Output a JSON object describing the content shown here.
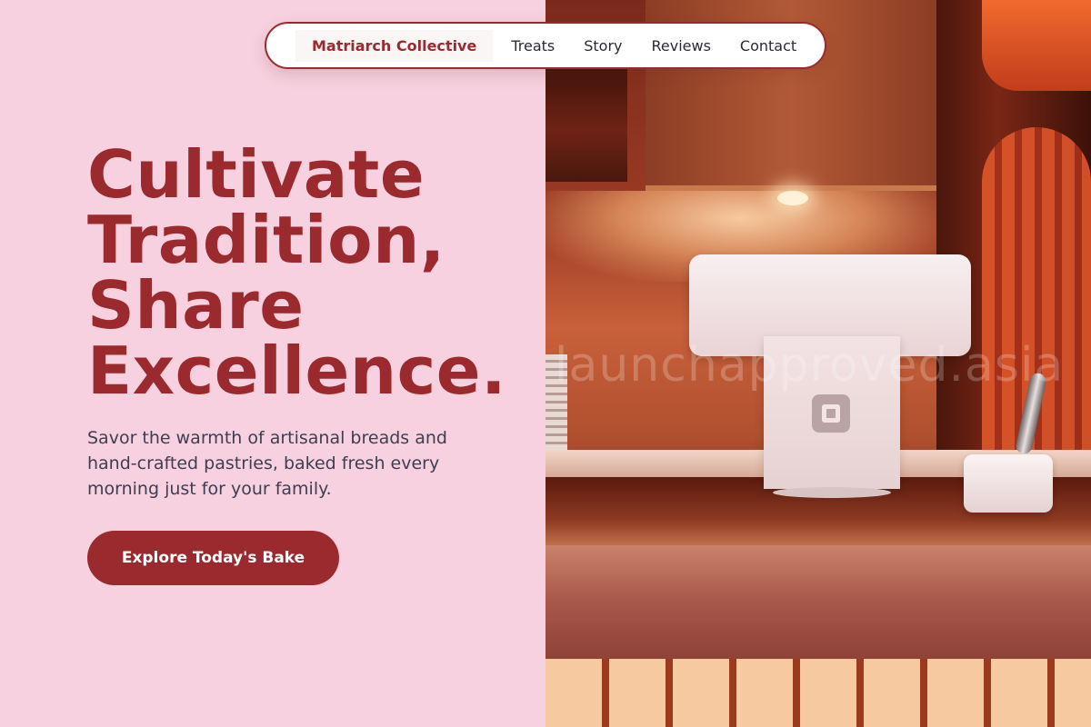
{
  "nav": {
    "brand": "Matriarch Collective",
    "links": [
      "Treats",
      "Story",
      "Reviews",
      "Contact"
    ]
  },
  "hero": {
    "title_lines": [
      "Cultivate",
      "Tradition,",
      "Share",
      "Excellence."
    ],
    "subtitle": "Savor the warmth of artisanal breads and hand-crafted pastries, baked fresh every morning just for your family.",
    "cta_label": "Explore Today's Bake"
  },
  "photo": {
    "watermark": "launchapproved.asia"
  },
  "colors": {
    "accent": "#9b2a2e",
    "background": "#f7d1df",
    "text": "#3e3e52"
  }
}
